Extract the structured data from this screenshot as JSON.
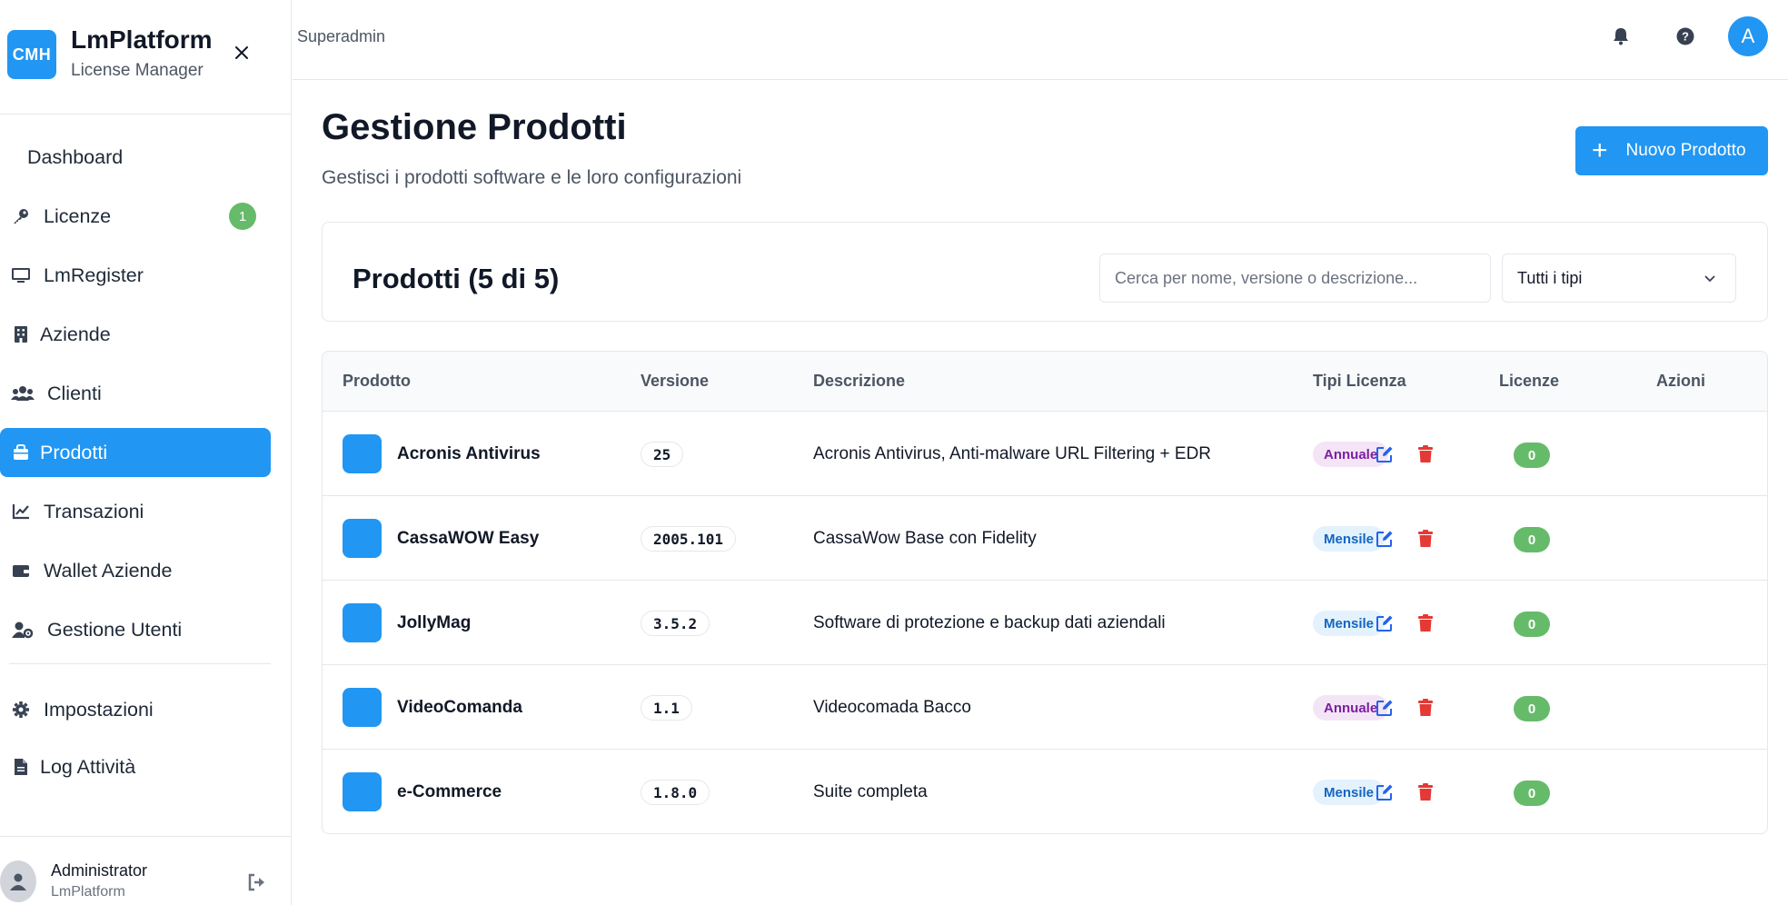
{
  "brand": {
    "logo": "CMH",
    "title": "LmPlatform",
    "subtitle": "License Manager"
  },
  "sidebar": {
    "items": [
      {
        "label": "Dashboard",
        "icon": "none"
      },
      {
        "label": "Licenze",
        "icon": "key-icon",
        "badge": "1"
      },
      {
        "label": "LmRegister",
        "icon": "monitor-icon"
      },
      {
        "label": "Aziende",
        "icon": "building-icon"
      },
      {
        "label": "Clienti",
        "icon": "users-icon"
      },
      {
        "label": "Prodotti",
        "icon": "box-icon",
        "active": true
      },
      {
        "label": "Transazioni",
        "icon": "chart-line-icon"
      },
      {
        "label": "Wallet Aziende",
        "icon": "wallet-icon"
      },
      {
        "label": "Gestione Utenti",
        "icon": "user-cog-icon"
      }
    ],
    "secondary": [
      {
        "label": "Impostazioni",
        "icon": "gear-icon"
      },
      {
        "label": "Log Attività",
        "icon": "file-icon"
      }
    ]
  },
  "user": {
    "name": "Administrator",
    "org": "LmPlatform"
  },
  "topbar": {
    "role": "Superadmin",
    "avatar_letter": "A"
  },
  "page": {
    "title": "Gestione Prodotti",
    "subtitle": "Gestisci i prodotti software e le loro configurazioni",
    "new_button": "Nuovo Prodotto"
  },
  "filters": {
    "title": "Prodotti (5 di 5)",
    "search_placeholder": "Cerca per nome, versione o descrizione...",
    "type_selected": "Tutti i tipi"
  },
  "table": {
    "headers": [
      "Prodotto",
      "Versione",
      "Descrizione",
      "Tipi Licenza",
      "Licenze",
      "Azioni"
    ],
    "rows": [
      {
        "name": "Acronis Antivirus",
        "version": "25",
        "description": "Acronis Antivirus, Anti-malware URL Filtering + EDR",
        "license_type": "Annuale",
        "licenses": "0"
      },
      {
        "name": "CassaWOW Easy",
        "version": "2005.101",
        "description": "CassaWow Base con Fidelity",
        "license_type": "Mensile",
        "licenses": "0"
      },
      {
        "name": "JollyMag",
        "version": "3.5.2",
        "description": "Software di protezione e backup dati aziendali",
        "license_type": "Mensile",
        "licenses": "0"
      },
      {
        "name": "VideoComanda",
        "version": "1.1",
        "description": "Videocomada Bacco",
        "license_type": "Annuale",
        "licenses": "0"
      },
      {
        "name": "e-Commerce",
        "version": "1.8.0",
        "description": "Suite completa",
        "license_type": "Mensile",
        "licenses": "0"
      }
    ]
  },
  "colors": {
    "primary": "#2196f3",
    "success": "#66bb6a",
    "danger": "#e53935",
    "annual_bg": "#f3e5f5",
    "annual_fg": "#7b1fa2",
    "monthly_bg": "#e3f2fd",
    "monthly_fg": "#1565c0"
  }
}
